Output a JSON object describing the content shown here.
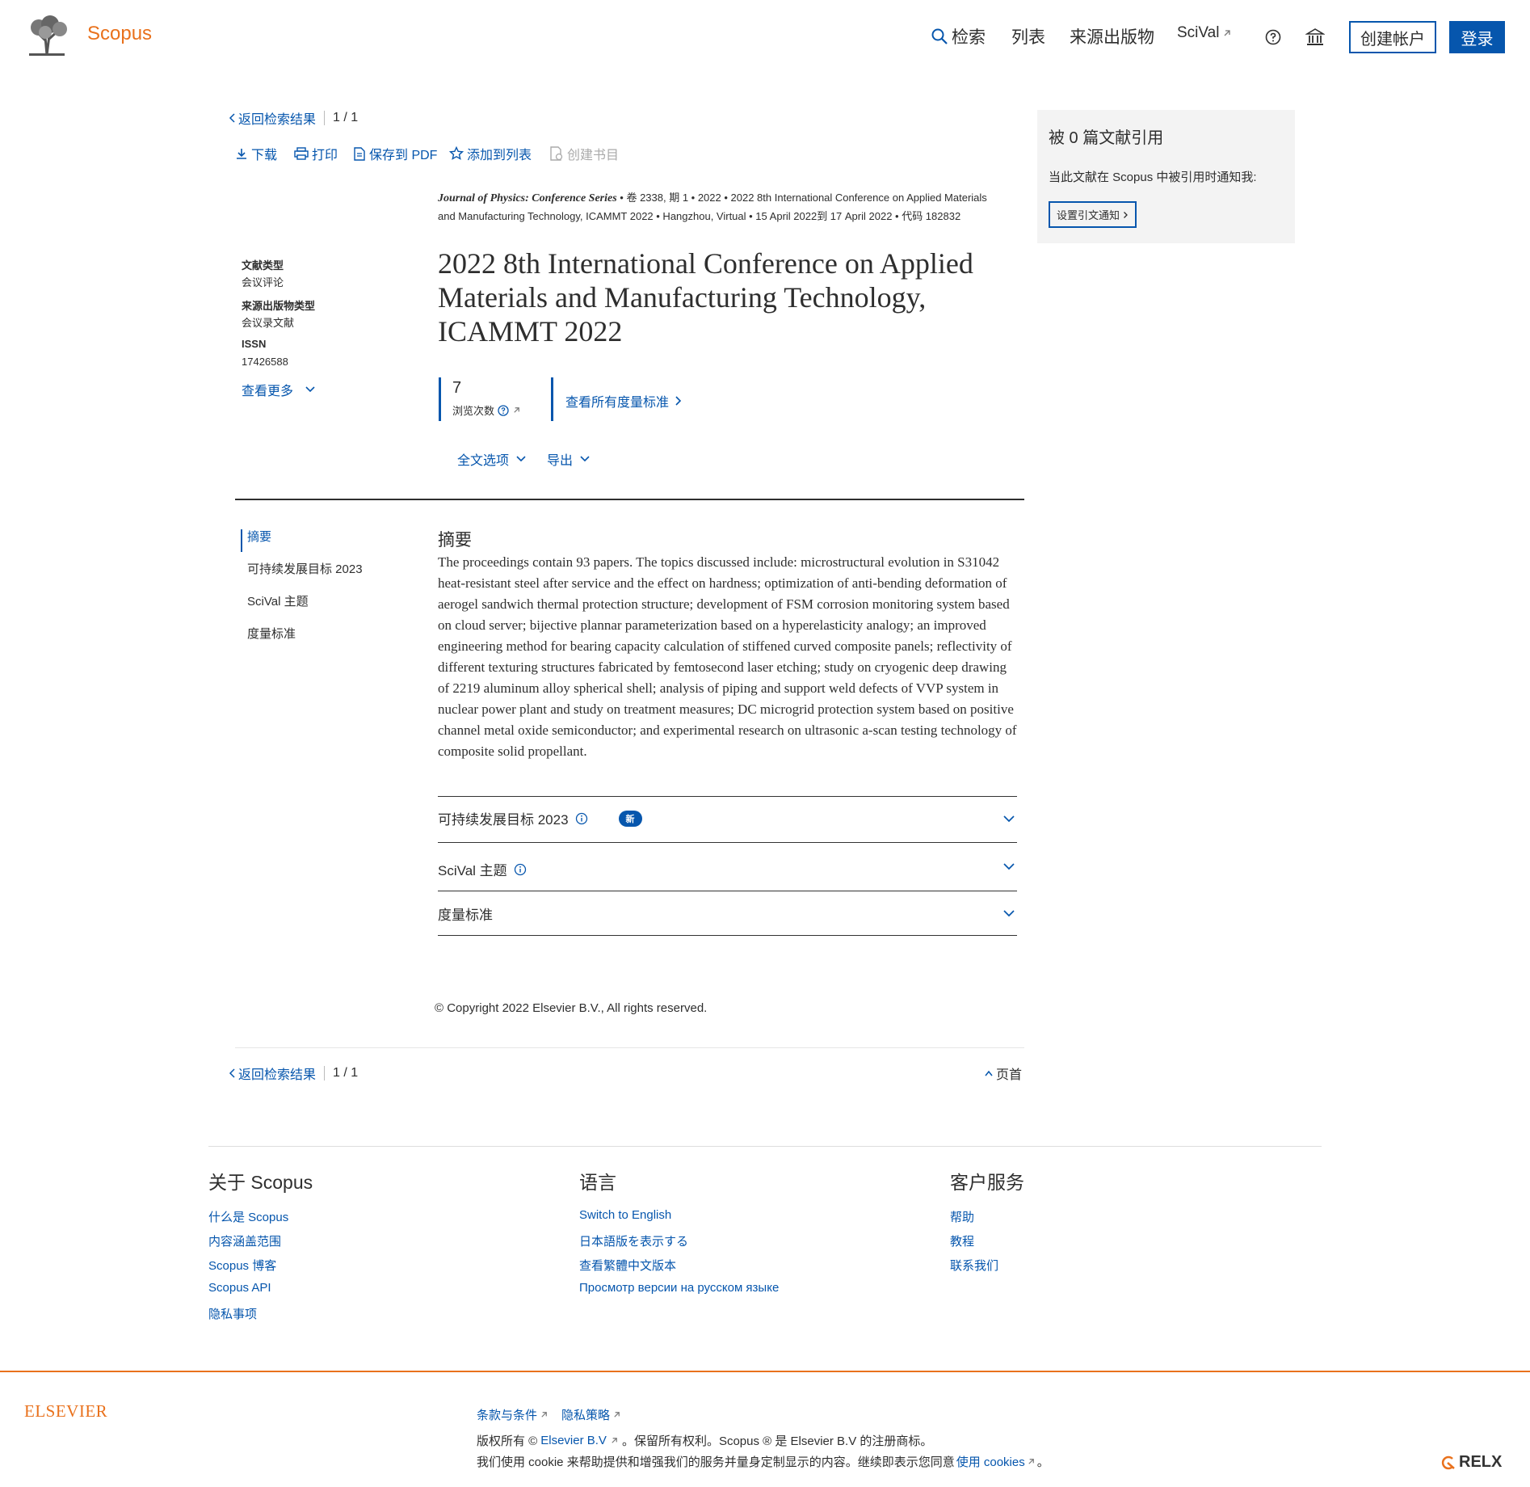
{
  "header": {
    "brand": "Scopus",
    "nav": {
      "search": "检索",
      "lists": "列表",
      "sources": "来源出版物",
      "scival": "SciVal"
    },
    "create_account": "创建帐户",
    "login": "登录"
  },
  "breadcrumb": {
    "back": "返回检索结果",
    "pager": "1 / 1"
  },
  "toolbar": {
    "download": "下载",
    "print": "打印",
    "save_pdf": "保存到 PDF",
    "add_list": "添加到列表",
    "create_bib": "创建书目"
  },
  "source_meta": {
    "journal": "Journal of Physics: Conference Series",
    "line1_rest": "• 卷 2338, 期 1 • 2022 • 2022 8th International Conference on Applied Materials",
    "line2": "and Manufacturing Technology, ICAMMT 2022 • Hangzhou, Virtual • 15 April 2022到 17 April 2022 • 代码 182832"
  },
  "doc_info": {
    "doc_type_label": "文献类型",
    "doc_type": "会议评论",
    "source_type_label": "来源出版物类型",
    "source_type": "会议录文献",
    "issn_label": "ISSN",
    "issn": "17426588",
    "see_more": "查看更多"
  },
  "title": "2022 8th International Conference on Applied Materials and Manufacturing Technology, ICAMMT 2022",
  "metrics": {
    "views": "7",
    "views_label": "浏览次数",
    "see_all": "查看所有度量标准"
  },
  "options": {
    "full_text": "全文选项",
    "export": "导出"
  },
  "side_nav": [
    "摘要",
    "可持续发展目标 2023",
    "SciVal 主题",
    "度量标准"
  ],
  "abstract": {
    "heading": "摘要",
    "text": "The proceedings contain 93 papers. The topics discussed include: microstructural evolution in S31042 heat-resistant steel after service and the effect on hardness; optimization of anti-bending deformation of aerogel sandwich thermal protection structure; development of FSM corrosion monitoring system based on cloud server; bijective plannar parameterization based on a hyperelasticity analogy; an improved engineering method for bearing capacity calculation of stiffened curved composite panels; reflectivity of different texturing structures fabricated by femtosecond laser etching; study on cryogenic deep drawing of 2219 aluminum alloy spherical shell; analysis of piping and support weld defects of VVP system in nuclear power plant and study on treatment measures; DC microgrid protection system based on positive channel metal oxide semiconductor; and experimental research on ultrasonic a-scan testing technology of composite solid propellant."
  },
  "accordion": {
    "sdg": "可持续发展目标 2023",
    "new_badge": "新",
    "scival": "SciVal 主题",
    "metrics": "度量标准"
  },
  "copyright": "© Copyright 2022 Elsevier B.V., All rights reserved.",
  "back_to_top": "页首",
  "cited_by": {
    "title": "被 0 篇文献引用",
    "notify_text": "当此文献在 Scopus 中被引用时通知我:",
    "button": "设置引文通知"
  },
  "footer": {
    "about": {
      "heading": "关于 Scopus",
      "links": [
        "什么是 Scopus",
        "内容涵盖范围",
        "Scopus 博客",
        "Scopus API",
        "隐私事项"
      ]
    },
    "language": {
      "heading": "语言",
      "links": [
        "Switch to English",
        "日本語版を表示する",
        "查看繁體中文版本",
        "Просмотр версии на русском языке"
      ]
    },
    "service": {
      "heading": "客户服务",
      "links": [
        "帮助",
        "教程",
        "联系我们"
      ]
    }
  },
  "bottom": {
    "elsevier": "ELSEVIER",
    "terms": "条款与条件",
    "privacy": "隐私策略",
    "rights_prefix": "版权所有 ©",
    "elsevier_bv": "Elsevier B.V",
    "rights_suffix": "。保留所有权利。Scopus ® 是 Elsevier B.V 的注册商标。",
    "cookie_prefix": "我们使用 cookie 来帮助提供和增强我们的服务并量身定制显示的内容。继续即表示您同意",
    "cookie_link": "使用 cookies",
    "cookie_suffix": "。",
    "relx": "RELX"
  }
}
